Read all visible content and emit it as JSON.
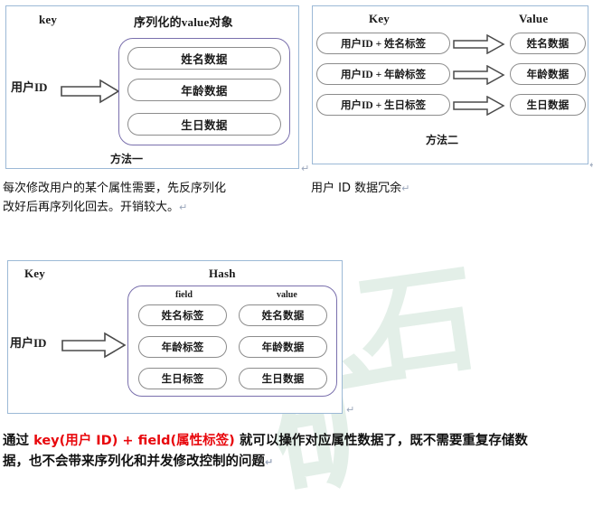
{
  "watermark": {
    "char_a": "石",
    "char_b": "矿"
  },
  "diagram1": {
    "header_key": "key",
    "header_value": "序列化的value对象",
    "key_label": "用户ID",
    "caption": "方法一",
    "arrow_icon": "block-arrow-right-icon",
    "values": [
      "姓名数据",
      "年龄数据",
      "生日数据"
    ]
  },
  "diagram2": {
    "header_key": "Key",
    "header_value": "Value",
    "caption": "方法二",
    "arrow_icon": "block-arrow-right-icon",
    "rows": [
      {
        "key": "用户ID + 姓名标签",
        "value": "姓名数据"
      },
      {
        "key": "用户ID + 年龄标签",
        "value": "年龄数据"
      },
      {
        "key": "用户ID + 生日标签",
        "value": "生日数据"
      }
    ]
  },
  "diagram3": {
    "header_key": "Key",
    "header_hash": "Hash",
    "sub_field": "field",
    "sub_value": "value",
    "key_label": "用户ID",
    "arrow_icon": "block-arrow-right-icon",
    "rows": [
      {
        "field": "姓名标签",
        "value": "姓名数据"
      },
      {
        "field": "年龄标签",
        "value": "年龄数据"
      },
      {
        "field": "生日标签",
        "value": "生日数据"
      }
    ]
  },
  "note1": {
    "line1": "每次修改用户的某个属性需要，先反序列化",
    "line2": "改好后再序列化回去。开销较大。",
    "mark": "↵"
  },
  "note2": {
    "text": "用户 ID 数据冗余",
    "mark": "↵"
  },
  "conclusion": {
    "pre": "通过 ",
    "highlight": "key(用户 ID) + field(属性标签)",
    "post_line1": " 就可以操作对应属性数据了，既不需要重复存储数",
    "line2": "据，也不会带来序列化和并发修改控制的问题",
    "mark": "↵"
  },
  "marks": {
    "d1": "↵",
    "d2": "↵",
    "d3": "↵"
  }
}
